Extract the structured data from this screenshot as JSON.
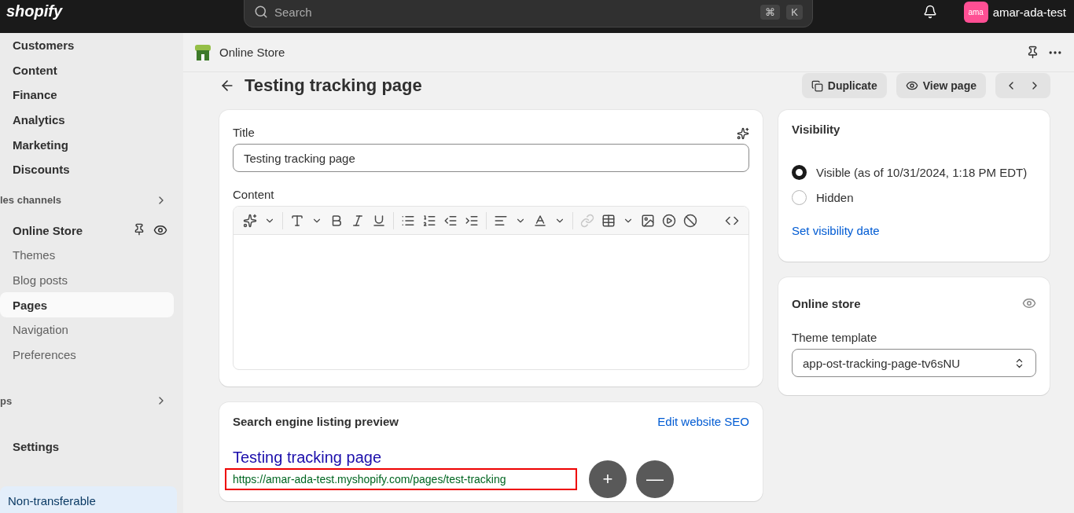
{
  "topbar": {
    "logo": "shopify",
    "search": {
      "placeholder": "Search",
      "keys": [
        "⌘",
        "K"
      ]
    },
    "account": {
      "avatar": "ama",
      "name": "amar-ada-test"
    }
  },
  "sidebar": {
    "top_items": [
      {
        "label": "Customers",
        "selected": false
      },
      {
        "label": "Content",
        "selected": false
      },
      {
        "label": "Finance",
        "selected": false
      },
      {
        "label": "Analytics",
        "selected": false
      },
      {
        "label": "Marketing",
        "selected": false
      },
      {
        "label": "Discounts",
        "selected": false
      }
    ],
    "channels_header": "les channels",
    "channel": {
      "label": "Online Store",
      "children": [
        {
          "label": "Themes",
          "selected": false
        },
        {
          "label": "Blog posts",
          "selected": false
        },
        {
          "label": "Pages",
          "selected": true
        },
        {
          "label": "Navigation",
          "selected": false
        },
        {
          "label": "Preferences",
          "selected": false
        }
      ]
    },
    "apps_header": "ps",
    "settings": "Settings",
    "notice": "Non-transferable"
  },
  "header": {
    "title": "Online Store"
  },
  "page": {
    "title": "Testing tracking page",
    "actions": [
      "Duplicate",
      "View page"
    ]
  },
  "editor": {
    "title_label": "Title",
    "title_value": "Testing tracking page",
    "content_label": "Content",
    "toolbar": {
      "link_disabled": true
    }
  },
  "seo": {
    "title": "Search engine listing preview",
    "edit_link": "Edit website SEO",
    "preview_title": "Testing tracking page",
    "preview_url": "https://amar-ada-test.myshopify.com/pages/test-tracking"
  },
  "visibility": {
    "title": "Visibility",
    "options": [
      {
        "label": "Visible (as of 10/31/2024, 1:18 PM EDT)",
        "selected": true
      },
      {
        "label": "Hidden",
        "selected": false
      }
    ],
    "link": "Set visibility date"
  },
  "online_store": {
    "title": "Online store",
    "template_label": "Theme template",
    "template_value": "app-ost-tracking-page-tv6sNU"
  },
  "zoom_controls": [
    "+",
    "—"
  ]
}
